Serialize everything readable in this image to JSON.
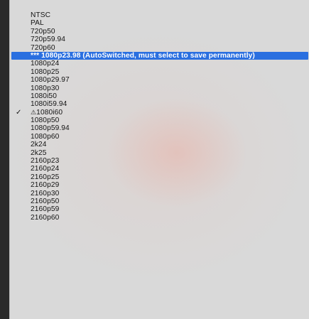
{
  "menu": {
    "items": [
      {
        "label": "NTSC"
      },
      {
        "label": "PAL"
      },
      {
        "label": "720p50"
      },
      {
        "label": "720p59.94"
      },
      {
        "label": "720p60"
      },
      {
        "label": "*** 1080p23.98 (AutoSwitched, must select to save permanently)",
        "highlighted": true
      },
      {
        "label": "1080p24"
      },
      {
        "label": "1080p25"
      },
      {
        "label": "1080p29.97"
      },
      {
        "label": "1080p30"
      },
      {
        "label": "1080i50"
      },
      {
        "label": "1080i59.94"
      },
      {
        "label": "1080i60",
        "checked": true,
        "warning": true,
        "check_glyph": "✓",
        "warning_glyph": "⚠"
      },
      {
        "label": "1080p50"
      },
      {
        "label": "1080p59.94"
      },
      {
        "label": "1080p60"
      },
      {
        "label": "2k24"
      },
      {
        "label": "2k25"
      },
      {
        "label": "2160p23"
      },
      {
        "label": "2160p24"
      },
      {
        "label": "2160p25"
      },
      {
        "label": "2160p29"
      },
      {
        "label": "2160p30"
      },
      {
        "label": "2160p50"
      },
      {
        "label": "2160p59"
      },
      {
        "label": "2160p60"
      }
    ]
  },
  "colors": {
    "highlight": "#2a6fe0",
    "menu_background": "#d9d9d9",
    "text": "#141414"
  },
  "icons": {
    "checked": "checkmark-icon",
    "warning": "warning-triangle-icon"
  }
}
